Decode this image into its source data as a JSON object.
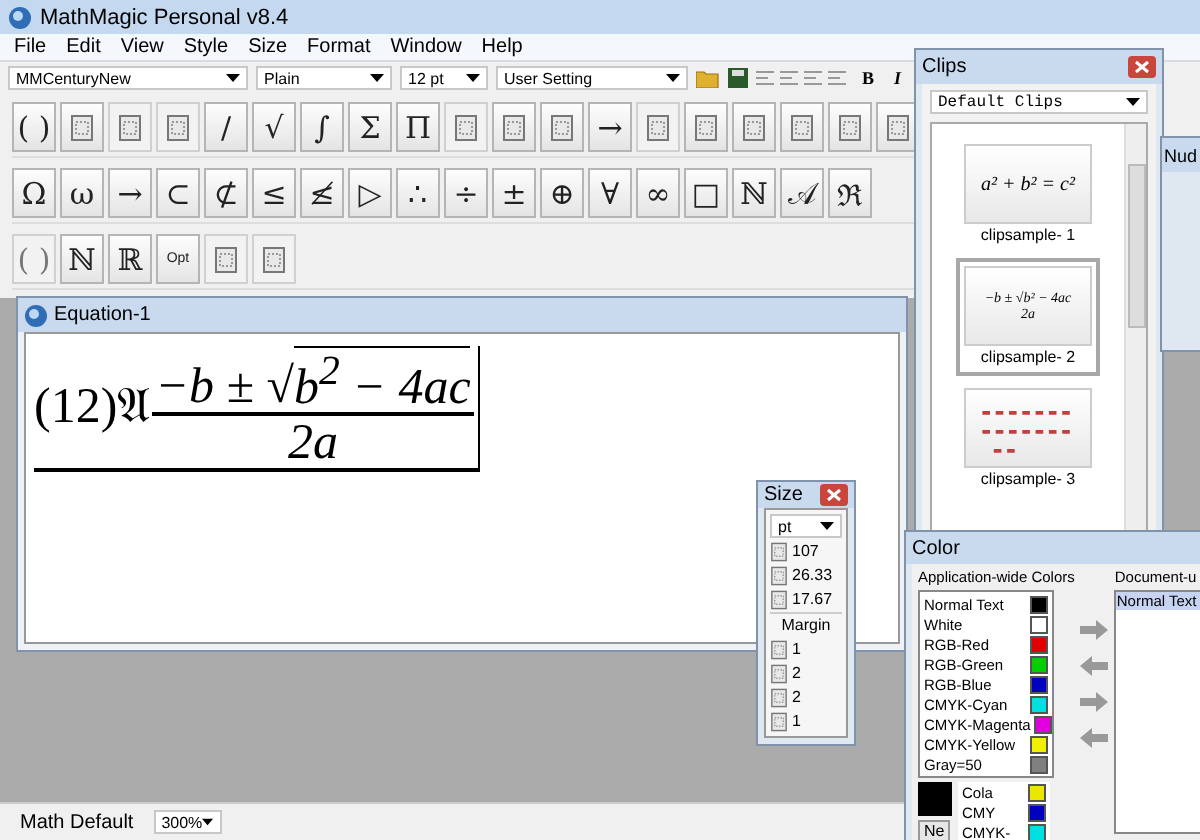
{
  "window": {
    "title": "MathMagic Personal v8.4"
  },
  "menu": [
    "File",
    "Edit",
    "View",
    "Style",
    "Size",
    "Format",
    "Window",
    "Help"
  ],
  "format_toolbar": {
    "font": "MMCenturyNew",
    "style": "Plain",
    "size": "12 pt",
    "setting": "User Setting",
    "buttons": [
      "B",
      "I"
    ]
  },
  "palette_rows": [
    [
      {
        "kind": "glyph",
        "symbol": "( )",
        "disabled": false
      },
      {
        "kind": "template",
        "disabled": false
      },
      {
        "kind": "template",
        "disabled": true
      },
      {
        "kind": "template",
        "disabled": true
      },
      {
        "kind": "glyph",
        "symbol": "/",
        "disabled": false
      },
      {
        "kind": "glyph",
        "symbol": "√",
        "disabled": false
      },
      {
        "kind": "glyph",
        "symbol": "∫",
        "disabled": false
      },
      {
        "kind": "glyph",
        "symbol": "Σ",
        "disabled": false
      },
      {
        "kind": "glyph",
        "symbol": "Π",
        "disabled": false
      },
      {
        "kind": "template",
        "disabled": true
      },
      {
        "kind": "template",
        "disabled": false
      },
      {
        "kind": "template",
        "disabled": false
      },
      {
        "kind": "glyph",
        "symbol": "→",
        "disabled": false
      },
      {
        "kind": "template",
        "disabled": true
      },
      {
        "kind": "template",
        "disabled": false
      },
      {
        "kind": "template",
        "disabled": false
      },
      {
        "kind": "template",
        "disabled": false
      },
      {
        "kind": "template",
        "disabled": false
      },
      {
        "kind": "template",
        "disabled": false
      }
    ],
    [
      {
        "kind": "glyph",
        "symbol": "Ω",
        "disabled": false
      },
      {
        "kind": "glyph",
        "symbol": "ω",
        "disabled": false
      },
      {
        "kind": "glyph",
        "symbol": "→",
        "disabled": false
      },
      {
        "kind": "glyph",
        "symbol": "⊂",
        "disabled": false
      },
      {
        "kind": "glyph",
        "symbol": "⊄",
        "disabled": false
      },
      {
        "kind": "glyph",
        "symbol": "≤",
        "disabled": false
      },
      {
        "kind": "glyph",
        "symbol": "≰",
        "disabled": false
      },
      {
        "kind": "glyph",
        "symbol": "▷",
        "disabled": false
      },
      {
        "kind": "glyph",
        "symbol": "∴",
        "disabled": false
      },
      {
        "kind": "glyph",
        "symbol": "÷",
        "disabled": false
      },
      {
        "kind": "glyph",
        "symbol": "±",
        "disabled": false
      },
      {
        "kind": "glyph",
        "symbol": "⊕",
        "disabled": false
      },
      {
        "kind": "glyph",
        "symbol": "∀",
        "disabled": false
      },
      {
        "kind": "glyph",
        "symbol": "∞",
        "disabled": false
      },
      {
        "kind": "glyph",
        "symbol": "□",
        "disabled": false
      },
      {
        "kind": "glyph",
        "symbol": "ℕ",
        "disabled": false
      },
      {
        "kind": "glyph",
        "symbol": "𝒜",
        "disabled": false
      },
      {
        "kind": "glyph",
        "symbol": "ℜ",
        "disabled": false
      }
    ],
    [
      {
        "kind": "glyph",
        "symbol": "( )",
        "disabled": true
      },
      {
        "kind": "glyph",
        "symbol": "ℕ",
        "disabled": false
      },
      {
        "kind": "glyph",
        "symbol": "ℝ",
        "disabled": false
      },
      {
        "kind": "glyph",
        "symbol": "Opt",
        "disabled": false
      },
      {
        "kind": "template",
        "disabled": true
      },
      {
        "kind": "template",
        "disabled": true
      }
    ]
  ],
  "equation_window": {
    "title": "Equation-1",
    "number": "(12)",
    "prefix": "𝔄",
    "numerator": "−b ± ",
    "radical": "√",
    "radicand": "b$^{2}$ − 4ac",
    "denominator": "2a"
  },
  "size_panel": {
    "title": "Size",
    "unit": "pt",
    "values": [
      "107",
      "26.33",
      "17.67"
    ],
    "margin_label": "Margin",
    "margins": [
      "1",
      "2",
      "2",
      "1"
    ]
  },
  "clips_panel": {
    "title": "Clips",
    "set": "Default Clips",
    "clips": [
      {
        "name": "clipsample- 1",
        "preview": "a² + b² = c²",
        "selected": false
      },
      {
        "name": "clipsample- 2",
        "preview": "−b ± √b² − 4ac",
        "preview_lower": "2a",
        "selected": true
      },
      {
        "name": "clipsample- 3",
        "selected": false
      }
    ]
  },
  "nudge_panel": {
    "title": "Nud"
  },
  "color_panel": {
    "title": "Color",
    "app_heading": "Application-wide Colors",
    "doc_heading": "Document-u",
    "colors": [
      {
        "name": "Normal Text",
        "color": "#000000"
      },
      {
        "name": "White",
        "color": "#ffffff"
      },
      {
        "name": "RGB-Red",
        "color": "#e00000"
      },
      {
        "name": "RGB-Green",
        "color": "#00d000"
      },
      {
        "name": "RGB-Blue",
        "color": "#0000c0"
      },
      {
        "name": "CMYK-Cyan",
        "color": "#00e0e0"
      },
      {
        "name": "CMYK-Magenta",
        "color": "#e000e0"
      },
      {
        "name": "CMYK-Yellow",
        "color": "#f0f000"
      },
      {
        "name": "Gray=50",
        "color": "#808080"
      }
    ],
    "popup": [
      {
        "name": "Cola",
        "color": "#e8e800"
      },
      {
        "name": "CMY",
        "color": "#0000c0"
      },
      {
        "name": "CMYK-",
        "color": "#00e0e0"
      }
    ],
    "doc_colors": [
      {
        "name": "Normal Text",
        "selected": true
      }
    ],
    "new_button": "Ne"
  },
  "status_bar": {
    "style": "Math Default",
    "zoom": "300%"
  }
}
